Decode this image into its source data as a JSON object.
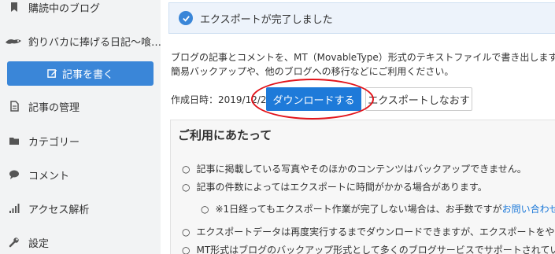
{
  "sidebar": {
    "items": [
      {
        "label": "購読中のブログ",
        "icon": "bookmark-icon"
      },
      {
        "label": "釣りバカに捧げる日記～喰…",
        "icon": "blog-avatar-icon"
      },
      {
        "label": "記事の管理",
        "icon": "document-icon"
      },
      {
        "label": "カテゴリー",
        "icon": "folder-icon"
      },
      {
        "label": "コメント",
        "icon": "comment-icon"
      },
      {
        "label": "アクセス解析",
        "icon": "bar-chart-icon"
      },
      {
        "label": "設定",
        "icon": "wrench-icon"
      }
    ],
    "write_button": "記事を書く"
  },
  "main": {
    "alert": "エクスポートが完了しました",
    "description_line1": "ブログの記事とコメントを、MT（MovableType）形式のテキストファイルで書き出します。",
    "description_line2": "簡易バックアップや、他のブログへの移行などにご利用ください。",
    "created_date": "作成日時：2019/12/21",
    "download_button": "ダウンロードする",
    "re_export_button": "エクスポートしなおす",
    "notes_title": "ご利用にあたって",
    "notes": [
      "記事に掲載している写真やそのほかのコンテンツはバックアップできません。",
      "記事の件数によってはエクスポートに時間がかかる場合があります。",
      "※1日経ってもエクスポート作業が完了しない場合は、お手数ですが",
      "お問い合わせ",
      "エクスポートデータは再度実行するまでダウンロードできますが、エクスポートをやり",
      "MT形式はブログのバックアップ形式として多くのブログサービスでサポートされてい"
    ]
  },
  "colors": {
    "accent": "#3a86d8",
    "highlight_circle": "#e2141b"
  }
}
